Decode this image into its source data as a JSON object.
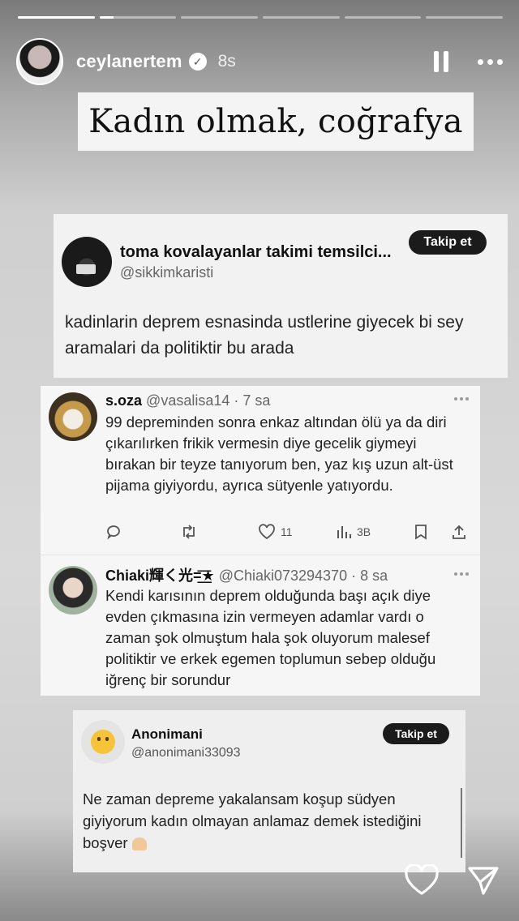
{
  "story": {
    "progress": [
      1,
      0.18,
      0,
      0,
      0,
      0
    ],
    "username": "ceylanertem",
    "time": "8s",
    "title": "Kadın olmak, coğrafya"
  },
  "tweet": {
    "name": "toma kovalayanlar takimi temsilci...",
    "handle": "@sikkimkaristi",
    "follow_label": "Takip et",
    "text": "kadinlarin deprem esnasinda ustlerine giyecek bi sey aramalari da politiktir bu arada"
  },
  "replies": [
    {
      "name": "s.oza",
      "meta": "@vasalisa14 · 7 sa",
      "text": "99 depreminden sonra enkaz altından ölü ya da diri çıkarılırken frikik vermesin diye gecelik giymeyi bırakan bir teyze tanıyorum ben, yaz kış uzun alt-üst pijama giyiyordu, ayrıca sütyenle yatıyordu.",
      "likes": "11",
      "views": "3B"
    },
    {
      "name": "Chiaki輝く光=͟͟͞★",
      "meta": "@Chiaki073294370 · 8 sa",
      "text": "Kendi karısının deprem olduğunda başı açık diye evden çıkmasına izin vermeyen adamlar vardı o zaman şok olmuştum hala şok oluyorum malesef politiktir ve erkek egemen toplumun sebep olduğu iğrenç bir sorundur"
    }
  ],
  "tweet3": {
    "name": "Anonimani",
    "handle": "@anonimani33093",
    "follow_label": "Takip et",
    "text": "Ne zaman depreme yakalansam koşup südyen giyiyorum kadın olmayan anlamaz demek istediğini boşver"
  },
  "icons": [
    "verified-icon",
    "pause-icon",
    "more-icon",
    "reply-icon",
    "retweet-icon",
    "like-icon",
    "views-icon",
    "bookmark-icon",
    "share-icon",
    "heart-icon",
    "send-icon"
  ]
}
